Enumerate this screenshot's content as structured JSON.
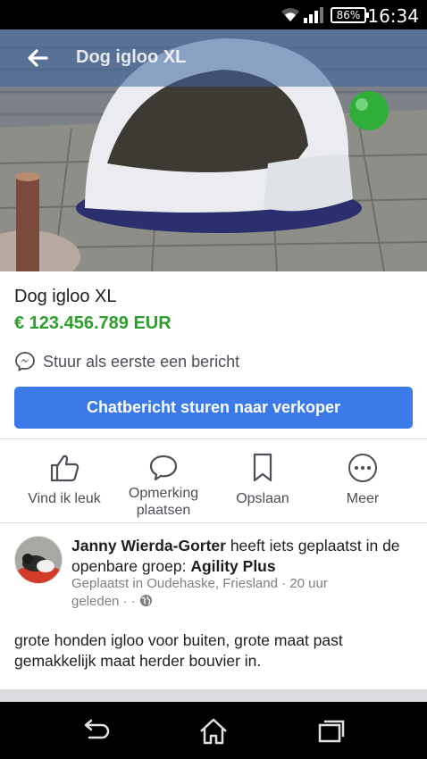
{
  "status_bar": {
    "battery": "86%",
    "time": "16:34"
  },
  "header": {
    "title": "Dog igloo XL"
  },
  "listing": {
    "title": "Dog igloo XL",
    "price": "€ 123.456.789 EUR",
    "message_prompt": "Stuur als eerste een bericht",
    "chat_button": "Chatbericht sturen naar verkoper"
  },
  "actions": [
    {
      "label": "Vind ik leuk",
      "icon": "thumbs-up-icon"
    },
    {
      "label": "Opmerking plaatsen",
      "icon": "comment-icon"
    },
    {
      "label": "Opslaan",
      "icon": "bookmark-icon"
    },
    {
      "label": "Meer",
      "icon": "more-icon"
    }
  ],
  "post": {
    "author": "Janny Wierda-Gorter",
    "action_text": " heeft iets geplaatst in de openbare groep: ",
    "group": "Agility Plus",
    "meta": "Geplaatst in Oudehaske, Friesland · 20 uur geleden · ·",
    "description": "grote honden igloo voor buiten, grote maat past gemakkelijk maat herder bouvier in."
  },
  "colors": {
    "accent": "#3b7ae8",
    "price": "#2e9e2e"
  }
}
